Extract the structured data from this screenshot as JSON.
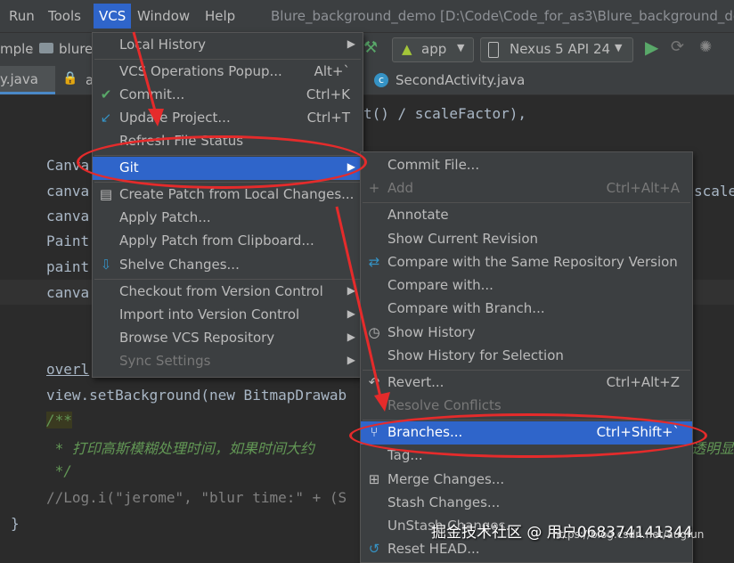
{
  "menubar": {
    "items": [
      "Run",
      "Tools",
      "VCS",
      "Window",
      "Help"
    ],
    "window_title": "Blure_background_demo [D:\\Code\\Code_for_as3\\Blure_background_de"
  },
  "toolbar": {
    "crumb1": "mple",
    "crumb2": "blure",
    "run_config": "app",
    "device": "Nexus 5 API 24"
  },
  "tabs": {
    "tab1": "y.java",
    "tab2": "a",
    "tab3": "SecondActivity.java"
  },
  "editor": {
    "lines": [
      "t() / scaleFactor),",
      "Canva",
      "canva",
      "canva",
      "Paint",
      "paint",
      "canva",
      "overl",
      "view.setBackground(new BitmapDrawab",
      "/**",
      " * 打印高斯模糊处理时间，如果时间大约",
      " */",
      "//Log.i(\"jerome\", \"blur time:\" + (S",
      "}"
    ],
    "right_scale": "scale",
    "right_fragment": "透明显"
  },
  "vcs_menu": {
    "items": [
      {
        "label": "Local History",
        "shortcut": "",
        "submenu": true
      },
      {
        "label": "VCS Operations Popup...",
        "shortcut": "Alt+`"
      },
      {
        "label": "Commit...",
        "shortcut": "Ctrl+K"
      },
      {
        "label": "Update Project...",
        "shortcut": "Ctrl+T"
      },
      {
        "label": "Refresh File Status",
        "shortcut": ""
      },
      {
        "label": "Git",
        "shortcut": "",
        "submenu": true
      },
      {
        "label": "Create Patch from Local Changes...",
        "shortcut": ""
      },
      {
        "label": "Apply Patch...",
        "shortcut": ""
      },
      {
        "label": "Apply Patch from Clipboard...",
        "shortcut": ""
      },
      {
        "label": "Shelve Changes...",
        "shortcut": ""
      },
      {
        "label": "Checkout from Version Control",
        "shortcut": "",
        "submenu": true
      },
      {
        "label": "Import into Version Control",
        "shortcut": "",
        "submenu": true
      },
      {
        "label": "Browse VCS Repository",
        "shortcut": "",
        "submenu": true
      },
      {
        "label": "Sync Settings",
        "shortcut": "",
        "submenu": true
      }
    ]
  },
  "git_menu": {
    "items": [
      {
        "label": "Commit File...",
        "shortcut": ""
      },
      {
        "label": "Add",
        "shortcut": "Ctrl+Alt+A"
      },
      {
        "label": "Annotate",
        "shortcut": ""
      },
      {
        "label": "Show Current Revision",
        "shortcut": ""
      },
      {
        "label": "Compare with the Same Repository Version",
        "shortcut": ""
      },
      {
        "label": "Compare with...",
        "shortcut": ""
      },
      {
        "label": "Compare with Branch...",
        "shortcut": ""
      },
      {
        "label": "Show History",
        "shortcut": ""
      },
      {
        "label": "Show History for Selection",
        "shortcut": ""
      },
      {
        "label": "Revert...",
        "shortcut": "Ctrl+Alt+Z"
      },
      {
        "label": "Resolve Conflicts",
        "shortcut": ""
      },
      {
        "label": "Branches...",
        "shortcut": "Ctrl+Shift+`"
      },
      {
        "label": "Tag...",
        "shortcut": ""
      },
      {
        "label": "Merge Changes...",
        "shortcut": ""
      },
      {
        "label": "Stash Changes...",
        "shortcut": ""
      },
      {
        "label": "UnStash Changes...",
        "shortcut": ""
      },
      {
        "label": "Reset HEAD...",
        "shortcut": ""
      }
    ]
  },
  "watermark": "掘金技术社区 @ 用户068374141344",
  "watermark_url": "https://blog.csdn.net/augfun",
  "colors": {
    "accent": "#2f65ca",
    "annotation": "#e52b2b"
  }
}
